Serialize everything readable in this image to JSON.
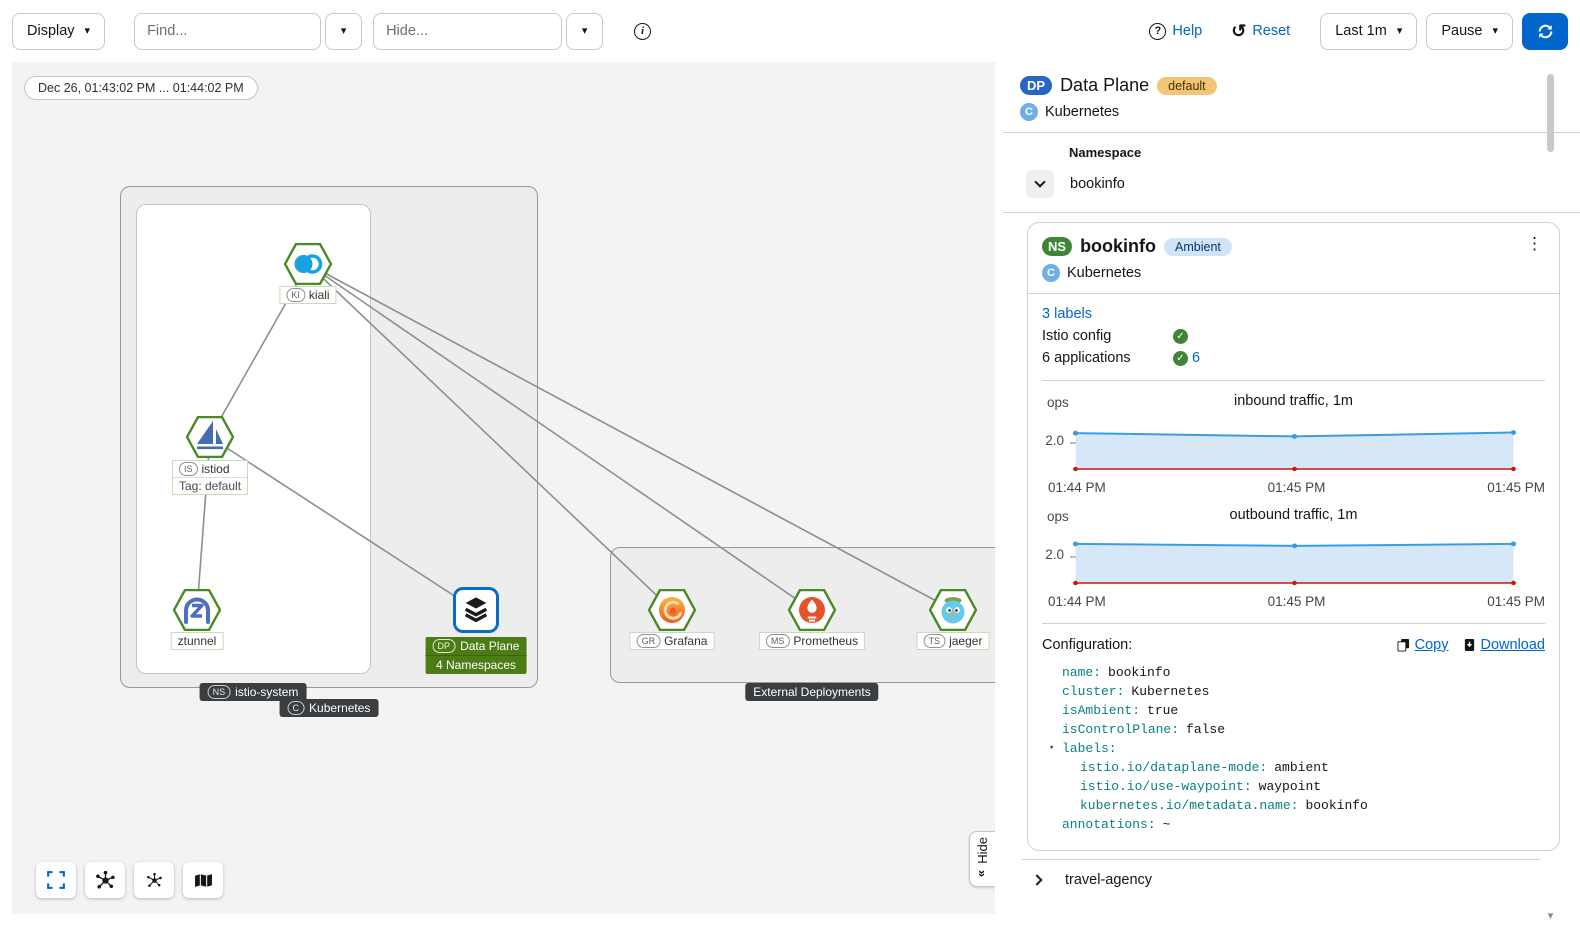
{
  "toolbar": {
    "display": "Display",
    "find_placeholder": "Find...",
    "hide_placeholder": "Hide...",
    "help": "Help",
    "reset": "Reset",
    "time_range": "Last 1m",
    "pause": "Pause"
  },
  "icons": {
    "caret_down": "▾",
    "info": "i",
    "help": "?",
    "reset": "↺",
    "kebab": "⋮",
    "check": "✓",
    "hide_chevrons": "»",
    "scroll_down": "▾"
  },
  "graph": {
    "time_badge": "Dec 26, 01:43:02 PM ... 01:44:02 PM",
    "hide_tab": "Hide",
    "boxes": {
      "namespace_badge": "NS",
      "namespace": "istio-system",
      "cluster_badge": "C",
      "cluster": "Kubernetes",
      "external": "External Deployments"
    },
    "nodes": {
      "kiali": {
        "badge": "KI",
        "label": "kiali"
      },
      "istiod": {
        "badge": "IS",
        "label": "istiod",
        "subtitle": "Tag: default"
      },
      "ztunnel": {
        "label": "ztunnel"
      },
      "dataplane": {
        "badge": "DP",
        "label": "Data Plane",
        "subtitle": "4 Namespaces"
      },
      "grafana": {
        "badge": "GR",
        "label": "Grafana"
      },
      "prometheus": {
        "badge": "MS",
        "label": "Prometheus"
      },
      "jaeger": {
        "badge": "TS",
        "label": "jaeger"
      }
    }
  },
  "panel": {
    "header": {
      "badge": "DP",
      "title": "Data Plane",
      "revision": "default",
      "cluster_badge": "C",
      "cluster": "Kubernetes"
    },
    "namespace_table": {
      "header": "Namespace",
      "selected": "bookinfo"
    },
    "card": {
      "badge": "NS",
      "name": "bookinfo",
      "mode": "Ambient",
      "cluster_badge": "C",
      "cluster": "Kubernetes",
      "labels_link": "3 labels",
      "istio_config": "Istio config",
      "applications": "6 applications",
      "applications_count": "6",
      "configuration_label": "Configuration:",
      "copy": "Copy",
      "download": "Download"
    },
    "collapsed_namespace": "travel-agency"
  },
  "chart_data": [
    {
      "type": "area",
      "title": "inbound traffic, 1m",
      "ylabel": "ops",
      "y_tick_label": "2.0",
      "y_tick_value": 2.0,
      "ylim": [
        0,
        3.3
      ],
      "grid": false,
      "x_ticks": [
        "01:44 PM",
        "01:45 PM",
        "01:45 PM"
      ],
      "series": [
        {
          "name": "ops",
          "color": "#3f9be0",
          "fill": "#d6e8f8",
          "values": [
            2.75,
            2.5,
            2.8
          ]
        },
        {
          "name": "errors",
          "color": "#c9190b",
          "fill": "none",
          "values": [
            0,
            0,
            0
          ]
        }
      ]
    },
    {
      "type": "area",
      "title": "outbound traffic, 1m",
      "ylabel": "ops",
      "y_tick_label": "2.0",
      "y_tick_value": 2.0,
      "ylim": [
        0,
        3.3
      ],
      "grid": false,
      "x_ticks": [
        "01:44 PM",
        "01:45 PM",
        "01:45 PM"
      ],
      "series": [
        {
          "name": "ops",
          "color": "#3f9be0",
          "fill": "#d6e8f8",
          "values": [
            3.0,
            2.85,
            3.0
          ]
        },
        {
          "name": "errors",
          "color": "#c9190b",
          "fill": "none",
          "values": [
            0,
            0,
            0
          ]
        }
      ]
    }
  ],
  "yaml": {
    "lines": [
      {
        "caret": "",
        "key": "name:",
        "value": "bookinfo"
      },
      {
        "caret": "",
        "key": "cluster:",
        "value": "Kubernetes"
      },
      {
        "caret": "",
        "key": "isAmbient:",
        "value": "true"
      },
      {
        "caret": "",
        "key": "isControlPlane:",
        "value": "false"
      },
      {
        "caret": "▾",
        "key": "labels:",
        "value": ""
      },
      {
        "caret": "",
        "key": "istio.io/dataplane-mode:",
        "value": "ambient"
      },
      {
        "caret": "",
        "key": "istio.io/use-waypoint:",
        "value": "waypoint"
      },
      {
        "caret": "",
        "key": "kubernetes.io/metadata.name:",
        "value": "bookinfo"
      },
      {
        "caret": "",
        "key": "annotations:",
        "value": "~"
      }
    ]
  },
  "colors": {
    "accent": "#0066cc",
    "link": "#0066cc",
    "healthy_green": "#3e8635",
    "hexagon_green": "#4a8a22",
    "default_badge_bg": "#f5c577",
    "ambient_badge_bg": "#d1e3f8",
    "dp_badge_bg": "#2666c5",
    "chart_line": "#3f9be0",
    "chart_error": "#c9190b"
  }
}
